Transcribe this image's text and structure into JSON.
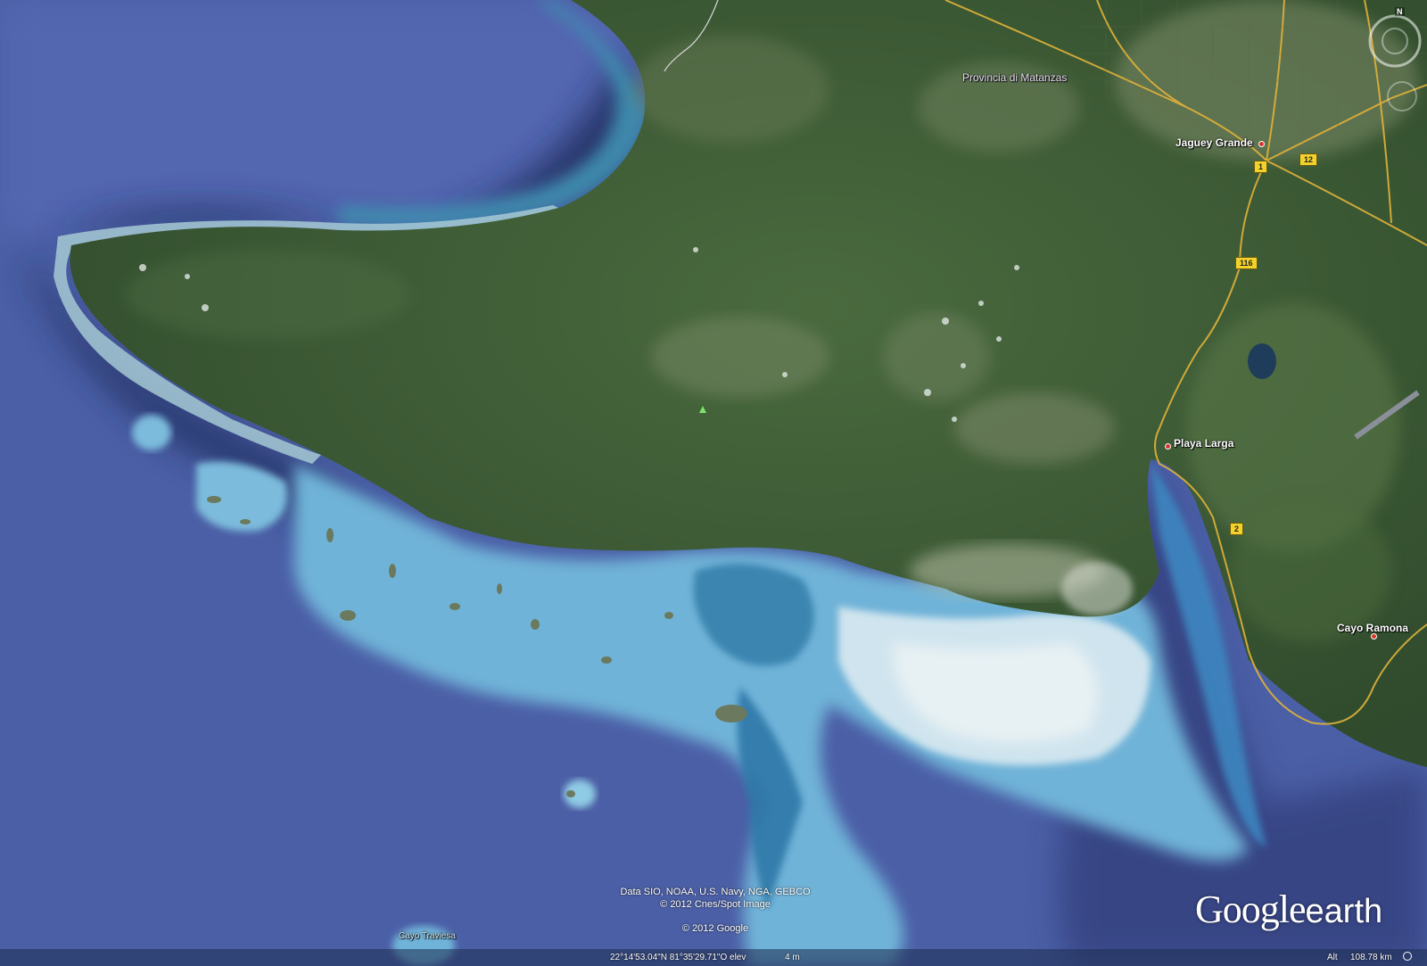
{
  "map": {
    "labels": {
      "province": "Provincia di Matanzas",
      "jaguey": "Jaguey Grande",
      "playa_larga": "Playa Larga",
      "cayo_ramona": "Cayo Ramona",
      "cayo_traviesa": "Cayo Traviesa"
    },
    "shields": {
      "r1": "1",
      "r12": "12",
      "r116": "116",
      "r2": "2"
    }
  },
  "attribution": {
    "line1": "Data SIO, NOAA, U.S. Navy, NGA, GEBCO",
    "line2": "© 2012 Cnes/Spot Image",
    "line3": "© 2012 Google"
  },
  "status": {
    "coords": "22°14'53.04\"N  81°35'29.71\"O elev",
    "elev": "4 m",
    "alt": "Alt",
    "alt_value": "108.78 km"
  },
  "logo": {
    "google": "Google",
    "earth": "earth"
  },
  "nav": {
    "north": "N"
  },
  "colors": {
    "ocean": "#4a5ea3",
    "land": "#3c5a34",
    "reef": "#8fc6e0",
    "road": "#e0b23a"
  }
}
